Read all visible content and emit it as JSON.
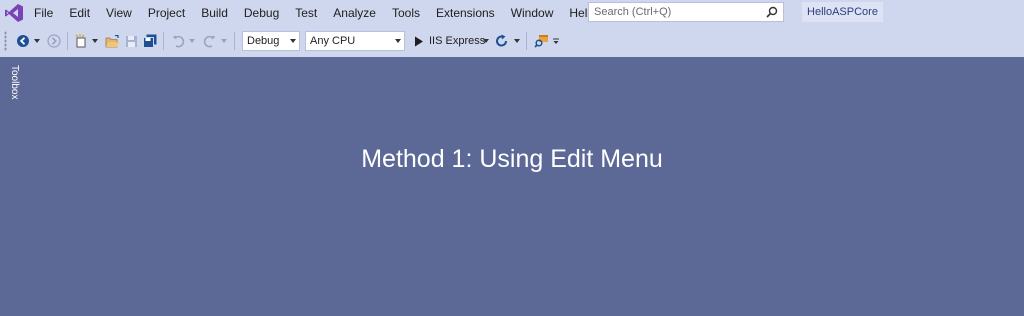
{
  "menubar": {
    "items": [
      "File",
      "Edit",
      "View",
      "Project",
      "Build",
      "Debug",
      "Test",
      "Analyze",
      "Tools",
      "Extensions",
      "Window",
      "Help"
    ],
    "search_placeholder": "Search (Ctrl+Q)",
    "project_name": "HelloASPCore"
  },
  "toolbar": {
    "configuration": "Debug",
    "platform": "Any CPU",
    "run_target": "IIS Express"
  },
  "sidebar": {
    "toolbox_label": "Toolbox"
  },
  "main": {
    "heading": "Method 1: Using Edit Menu"
  },
  "colors": {
    "chrome": "#cfd7ee",
    "workspace": "#5c6896",
    "vs_purple": "#68217a",
    "nav_blue": "#1e4f96"
  },
  "icons": [
    "visual-studio-logo-icon",
    "search-icon",
    "back-icon",
    "forward-icon",
    "new-project-icon",
    "open-folder-icon",
    "save-icon",
    "save-all-icon",
    "undo-icon",
    "redo-icon",
    "play-icon",
    "refresh-icon",
    "find-in-files-icon",
    "overflow-icon"
  ]
}
